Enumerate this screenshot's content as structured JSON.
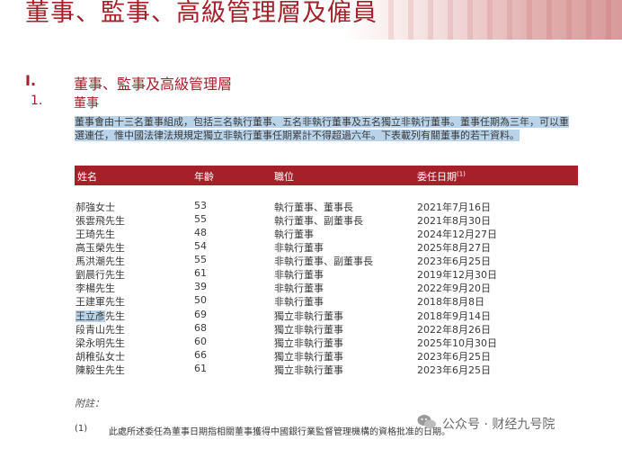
{
  "chapter_title": "董事、監事、高級管理層及僱員",
  "section": {
    "number": "I.",
    "title": "董事、監事及高級管理層"
  },
  "subsection": {
    "number": "1.",
    "title": "董事"
  },
  "intro": {
    "highlighted": "董事會由十三名董事組成，包括三名執行董事、五名非執行董事及五名獨立非執行董事。董事任期為三年，可以重選連任，惟中國法律法規規定獨立非執行董事任期累計不得超過六年。下表載列有關董事的若干資料。"
  },
  "table": {
    "headers": {
      "name": "姓名",
      "age": "年齡",
      "position": "職位",
      "date": "委任日期",
      "date_note": "(1)"
    },
    "rows": [
      {
        "name": "郝強女士",
        "age": "53",
        "position": "執行董事、董事長",
        "date": "2021年7月16日"
      },
      {
        "name": "張雲飛先生",
        "age": "55",
        "position": "執行董事、副董事長",
        "date": "2021年8月30日"
      },
      {
        "name": "王琦先生",
        "age": "48",
        "position": "執行董事",
        "date": "2024年12月27日"
      },
      {
        "name": "高玉榮先生",
        "age": "54",
        "position": "非執行董事",
        "date": "2025年8月27日"
      },
      {
        "name": "馬洪潮先生",
        "age": "55",
        "position": "非執行董事、副董事長",
        "date": "2023年6月25日"
      },
      {
        "name": "劉晨行先生",
        "age": "61",
        "position": "非執行董事",
        "date": "2019年12月30日"
      },
      {
        "name": "李楊先生",
        "age": "39",
        "position": "非執行董事",
        "date": "2022年9月20日"
      },
      {
        "name": "王建軍先生",
        "age": "50",
        "position": "非執行董事",
        "date": "2018年8月8日"
      },
      {
        "name_highlight": "王立彥",
        "name_rest": "先生",
        "age": "69",
        "position": "獨立非執行董事",
        "date": "2018年9月14日"
      },
      {
        "name": "段青山先生",
        "age": "68",
        "position": "獨立非執行董事",
        "date": "2022年8月26日"
      },
      {
        "name": "梁永明先生",
        "age": "60",
        "position": "獨立非執行董事",
        "date": "2025年10月30日"
      },
      {
        "name": "胡稚弘女士",
        "age": "66",
        "position": "獨立非執行董事",
        "date": "2023年6月25日"
      },
      {
        "name": "陳毅生先生",
        "age": "61",
        "position": "獨立非執行董事",
        "date": "2023年6月25日"
      }
    ]
  },
  "notes": {
    "label": "附註：",
    "footnote_number": "(1)",
    "footnote_text": "此處所述委任為董事日期指相關董事獲得中國銀行業監督管理機構的資格批准的日期。"
  },
  "watermark": {
    "text": "公众号 · 财经九号院",
    "icon": "wechat-icon"
  },
  "colors": {
    "accent": "#a6202a",
    "highlight": "#b9d4ea"
  }
}
